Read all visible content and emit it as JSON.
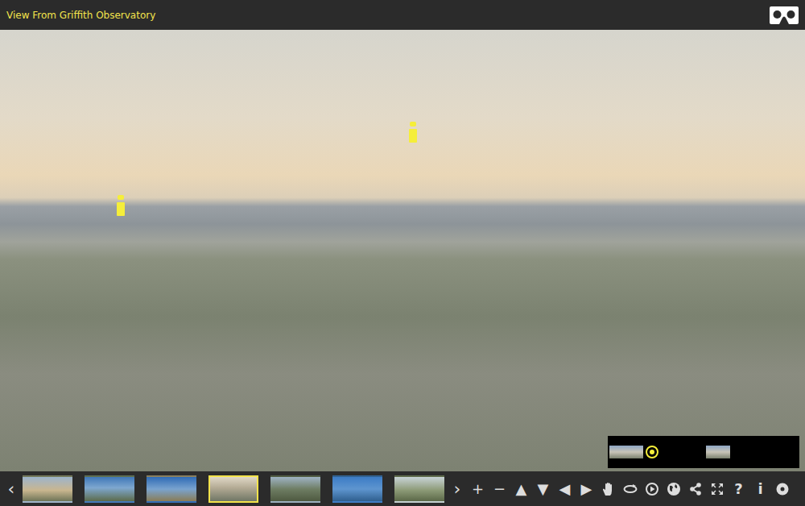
{
  "window": {
    "title": "View From Griffith Observatory"
  },
  "toolbar": {
    "prev": "‹",
    "next": "›",
    "thumbnails": [
      {
        "selected": false
      },
      {
        "selected": false
      },
      {
        "selected": false
      },
      {
        "selected": true
      },
      {
        "selected": false
      },
      {
        "selected": false
      },
      {
        "selected": false
      }
    ],
    "nav_controls": [
      "+",
      "−",
      "▲",
      "▼",
      "◀",
      "▶"
    ],
    "help_controls": [
      "?",
      "i"
    ]
  }
}
